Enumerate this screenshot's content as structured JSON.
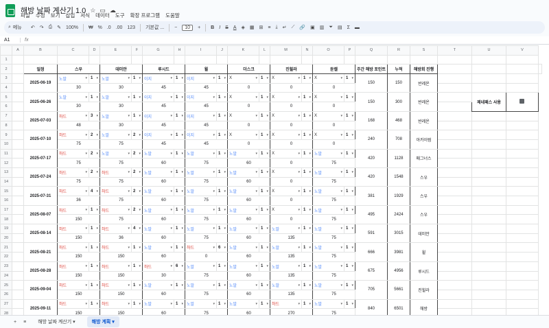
{
  "title": "해방 날짜 계산기 1.0",
  "menu": [
    "파일",
    "수정",
    "보기",
    "삽입",
    "서식",
    "데이터",
    "도구",
    "확장 프로그램",
    "도움말"
  ],
  "toolbar": {
    "search": "메뉴",
    "zoom": "100%",
    "currency": "₩",
    "percent": "%",
    "dec_less": ".0",
    "dec_more": ".00",
    "numfmt": "123",
    "font": "기본값 ...",
    "font_size": "10"
  },
  "namebox": "A1",
  "fx": "fx",
  "columns": [
    "A",
    "B",
    "C",
    "D",
    "E",
    "F",
    "G",
    "H",
    "I",
    "J",
    "K",
    "L",
    "M",
    "N",
    "O",
    "P",
    "Q",
    "R",
    "S",
    "T",
    "U",
    "V"
  ],
  "headers": {
    "date": "일정",
    "h1": "스우",
    "h2": "데미안",
    "h3": "루시드",
    "h4": "윌",
    "h5": "더스크",
    "h6": "진힐라",
    "h7": "듄켈",
    "weekly": "주간 해방 포인트",
    "cum": "누적",
    "prog": "해방회 진행"
  },
  "pass_label": "제네패스 사용",
  "weeks": [
    {
      "date": "2025-06-19",
      "c": [
        [
          "노말",
          "1",
          "30"
        ],
        [
          "노말",
          "1",
          "30"
        ],
        [
          "이지",
          "1",
          "45"
        ],
        [
          "이지",
          "1",
          "45"
        ],
        [
          "X",
          "1",
          "0"
        ],
        [
          "X",
          "1",
          "0"
        ],
        [
          "X",
          "1",
          "0"
        ]
      ],
      "w": "150",
      "cum": "150",
      "p": "반레온"
    },
    {
      "date": "2025-06-26",
      "c": [
        [
          "노말",
          "1",
          "30"
        ],
        [
          "노말",
          "1",
          "30"
        ],
        [
          "이지",
          "1",
          "45"
        ],
        [
          "이지",
          "1",
          "45"
        ],
        [
          "X",
          "1",
          "0"
        ],
        [
          "X",
          "1",
          "0"
        ],
        [
          "X",
          "1",
          "0"
        ]
      ],
      "w": "150",
      "cum": "300",
      "p": "반레온"
    },
    {
      "date": "2025-07-03",
      "c": [
        [
          "하드",
          "3",
          "48"
        ],
        [
          "노말",
          "1",
          "30"
        ],
        [
          "이지",
          "1",
          "45"
        ],
        [
          "이지",
          "1",
          "45"
        ],
        [
          "X",
          "1",
          "0"
        ],
        [
          "X",
          "1",
          "0"
        ],
        [
          "X",
          "1",
          "0"
        ]
      ],
      "w": "168",
      "cum": "468",
      "p": "반레온"
    },
    {
      "date": "2025-07-10",
      "c": [
        [
          "하드",
          "2",
          "75"
        ],
        [
          "노말",
          "2",
          "75"
        ],
        [
          "이지",
          "1",
          "45"
        ],
        [
          "이지",
          "1",
          "45"
        ],
        [
          "X",
          "1",
          "0"
        ],
        [
          "X",
          "1",
          "0"
        ],
        [
          "X",
          "1",
          "0"
        ]
      ],
      "w": "240",
      "cum": "708",
      "p": "아카이럼"
    },
    {
      "date": "2025-07-17",
      "c": [
        [
          "하드",
          "2",
          "75"
        ],
        [
          "노말",
          "2",
          "75"
        ],
        [
          "노말",
          "1",
          "60"
        ],
        [
          "노말",
          "1",
          "75"
        ],
        [
          "노말",
          "1",
          "60"
        ],
        [
          "X",
          "1",
          "0"
        ],
        [
          "노말",
          "1",
          "75"
        ]
      ],
      "w": "420",
      "cum": "1128",
      "p": "매그너스"
    },
    {
      "date": "2025-07-24",
      "c": [
        [
          "하드",
          "2",
          "75"
        ],
        [
          "하드",
          "2",
          "75"
        ],
        [
          "노말",
          "1",
          "60"
        ],
        [
          "노말",
          "1",
          "75"
        ],
        [
          "노말",
          "1",
          "60"
        ],
        [
          "X",
          "1",
          "0"
        ],
        [
          "노말",
          "1",
          "75"
        ]
      ],
      "w": "420",
      "cum": "1548",
      "p": "스우"
    },
    {
      "date": "2025-07-31",
      "c": [
        [
          "하드",
          "4",
          "36"
        ],
        [
          "하드",
          "2",
          "75"
        ],
        [
          "노말",
          "1",
          "60"
        ],
        [
          "노말",
          "1",
          "75"
        ],
        [
          "노말",
          "1",
          "60"
        ],
        [
          "X",
          "1",
          "0"
        ],
        [
          "노말",
          "1",
          "75"
        ]
      ],
      "w": "381",
      "cum": "1929",
      "p": "스우"
    },
    {
      "date": "2025-08-07",
      "c": [
        [
          "하드",
          "1",
          "150"
        ],
        [
          "하드",
          "2",
          "75"
        ],
        [
          "노말",
          "1",
          "60"
        ],
        [
          "노말",
          "1",
          "75"
        ],
        [
          "노말",
          "1",
          "60"
        ],
        [
          "X",
          "1",
          "0"
        ],
        [
          "노말",
          "1",
          "75"
        ]
      ],
      "w": "495",
      "cum": "2424",
      "p": "스우"
    },
    {
      "date": "2025-08-14",
      "c": [
        [
          "하드",
          "1",
          "150"
        ],
        [
          "하드",
          "4",
          "36"
        ],
        [
          "노말",
          "1",
          "60"
        ],
        [
          "노말",
          "1",
          "75"
        ],
        [
          "노말",
          "1",
          "60"
        ],
        [
          "노말",
          "1",
          "135"
        ],
        [
          "노말",
          "1",
          "75"
        ]
      ],
      "w": "591",
      "cum": "3015",
      "p": "데미안"
    },
    {
      "date": "2025-08-21",
      "c": [
        [
          "하드",
          "1",
          "150"
        ],
        [
          "하드",
          "1",
          "150"
        ],
        [
          "노말",
          "1",
          "60"
        ],
        [
          "하드",
          "6",
          "0"
        ],
        [
          "노말",
          "1",
          "60"
        ],
        [
          "노말",
          "1",
          "135"
        ],
        [
          "노말",
          "1",
          "75"
        ]
      ],
      "w": "666",
      "cum": "3981",
      "p": "윌"
    },
    {
      "date": "2025-08-28",
      "c": [
        [
          "하드",
          "1",
          "150"
        ],
        [
          "하드",
          "1",
          "150"
        ],
        [
          "하드",
          "6",
          "30"
        ],
        [
          "노말",
          "1",
          "75"
        ],
        [
          "노말",
          "1",
          "60"
        ],
        [
          "노말",
          "1",
          "135"
        ],
        [
          "노말",
          "1",
          "75"
        ]
      ],
      "w": "675",
      "cum": "4956",
      "p": "루시드"
    },
    {
      "date": "2025-09-04",
      "c": [
        [
          "하드",
          "1",
          "150"
        ],
        [
          "하드",
          "1",
          "150"
        ],
        [
          "노말",
          "1",
          "60"
        ],
        [
          "노말",
          "1",
          "75"
        ],
        [
          "노말",
          "1",
          "60"
        ],
        [
          "노말",
          "1",
          "135"
        ],
        [
          "노말",
          "1",
          "75"
        ]
      ],
      "w": "705",
      "cum": "5661",
      "p": "진힐라"
    },
    {
      "date": "2025-09-11",
      "c": [
        [
          "하드",
          "1",
          "150"
        ],
        [
          "하드",
          "1",
          "150"
        ],
        [
          "노말",
          "1",
          "60"
        ],
        [
          "노말",
          "1",
          "75"
        ],
        [
          "노말",
          "1",
          "60"
        ],
        [
          "하드",
          "1",
          "270"
        ],
        [
          "노말",
          "1",
          "75"
        ]
      ],
      "w": "840",
      "cum": "6501",
      "p": "해방"
    }
  ],
  "tabs": [
    "해방 날짜 계산기",
    "해방 계획"
  ]
}
